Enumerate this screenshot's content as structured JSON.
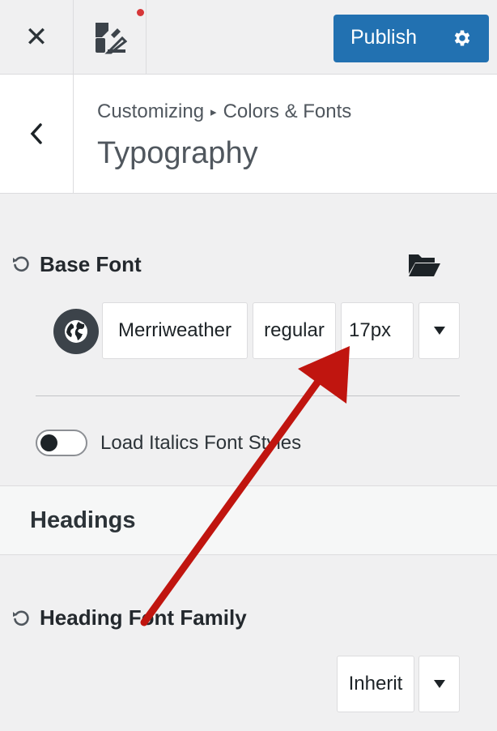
{
  "topbar": {
    "close_icon": "close-icon",
    "customizer_icon": "paint-brush-icon",
    "publish_label": "Publish",
    "settings_icon": "gear-icon",
    "notification_color": "#d63638"
  },
  "header": {
    "breadcrumb": [
      "Customizing",
      "Colors & Fonts"
    ],
    "breadcrumb_separator": "▸",
    "title": "Typography"
  },
  "base_font": {
    "label": "Base Font",
    "family": "Merriweather",
    "weight": "regular",
    "size": "17px",
    "italics_toggle_label": "Load Italics Font Styles",
    "italics_enabled": false
  },
  "headings": {
    "section_title": "Headings",
    "heading_font_label": "Heading Font Family",
    "heading_font_value": "Inherit"
  },
  "colors": {
    "accent": "#2271b1",
    "annotation_arrow": "#c0150f"
  }
}
